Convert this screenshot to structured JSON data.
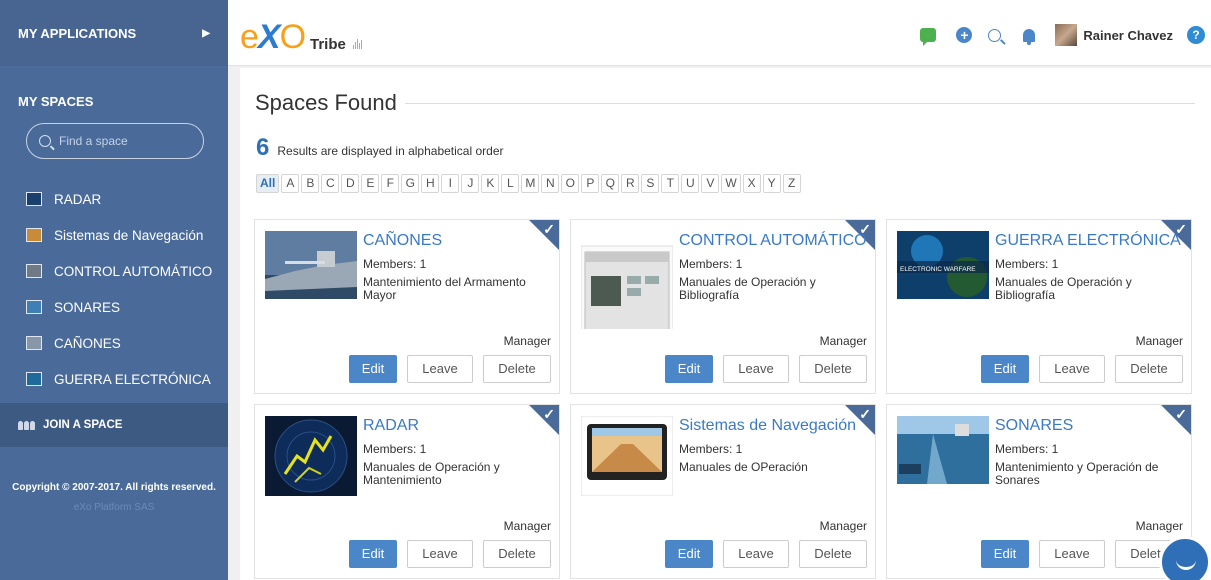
{
  "sidebar": {
    "apps_label": "MY APPLICATIONS",
    "spaces_title": "MY SPACES",
    "search_placeholder": "Find a space",
    "items": [
      {
        "label": "RADAR"
      },
      {
        "label": "Sistemas de Navegación"
      },
      {
        "label": "CONTROL AUTOMÁTICO"
      },
      {
        "label": "SONARES"
      },
      {
        "label": "CAÑONES"
      },
      {
        "label": "GUERRA ELECTRÓNICA"
      }
    ],
    "join_label": "JOIN A SPACE",
    "copyright": "Copyright © 2007-2017. All rights reserved.",
    "company": "eXo Platform SAS"
  },
  "topbar": {
    "logo_e": "e",
    "logo_x": "X",
    "logo_o": "O",
    "tribe": "Tribe",
    "username": "Rainer Chavez",
    "help": "?",
    "plus": "+"
  },
  "main": {
    "heading": "Spaces Found",
    "results_count": "6",
    "results_text": "Results are displayed in alphabetical order",
    "letters": [
      "All",
      "A",
      "B",
      "C",
      "D",
      "E",
      "F",
      "G",
      "H",
      "I",
      "J",
      "K",
      "L",
      "M",
      "N",
      "O",
      "P",
      "Q",
      "R",
      "S",
      "T",
      "U",
      "V",
      "W",
      "X",
      "Y",
      "Z"
    ]
  },
  "cards": [
    {
      "title": "CAÑONES",
      "members": "Members: 1",
      "desc": "Mantenimiento del Armamento Mayor",
      "role": "Manager",
      "edit": "Edit",
      "leave": "Leave",
      "delete": "Delete"
    },
    {
      "title": "CONTROL AUTOMÁTICO",
      "members": "Members: 1",
      "desc": "Manuales de Operación y Bibliografía",
      "role": "Manager",
      "edit": "Edit",
      "leave": "Leave",
      "delete": "Delete"
    },
    {
      "title": "GUERRA ELECTRÓNICA",
      "members": "Members: 1",
      "desc": "Manuales de Operación y Bibliografía",
      "role": "Manager",
      "edit": "Edit",
      "leave": "Leave",
      "delete": "Delete",
      "img_caption": "ELECTRONIC WARFARE"
    },
    {
      "title": "RADAR",
      "members": "Members: 1",
      "desc": "Manuales de Operación y Mantenimiento",
      "role": "Manager",
      "edit": "Edit",
      "leave": "Leave",
      "delete": "Delete"
    },
    {
      "title": "Sistemas de Navegación",
      "members": "Members: 1",
      "desc": "Manuales de OPeración",
      "role": "Manager",
      "edit": "Edit",
      "leave": "Leave",
      "delete": "Delete"
    },
    {
      "title": "SONARES",
      "members": "Members: 1",
      "desc": "Mantenimiento y Operación de Sonares",
      "role": "Manager",
      "edit": "Edit",
      "leave": "Leave",
      "delete": "Delete"
    }
  ],
  "colors": {
    "sidebar": "#4a6b9a",
    "accent": "#4a86c8",
    "title_link": "#3a7ac5",
    "logo_orange": "#f7a01b"
  }
}
